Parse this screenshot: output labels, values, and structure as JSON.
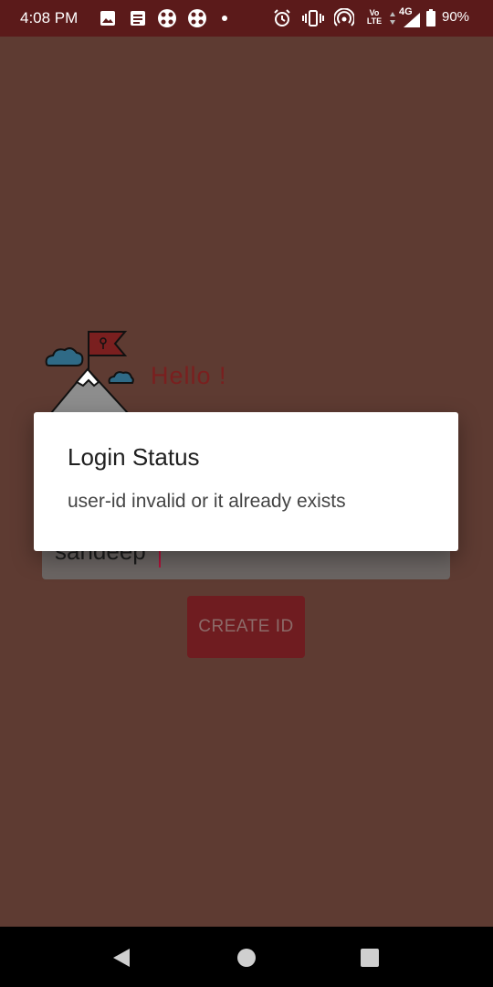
{
  "status_bar": {
    "time": "4:08 PM",
    "network": "4G",
    "battery": "90%",
    "icons": [
      "image-icon",
      "notes-icon",
      "app-icon",
      "app-icon",
      "dot-icon",
      "alarm-icon",
      "vibrate-icon",
      "hotspot-icon",
      "volte-icon",
      "signal-icon",
      "battery-icon"
    ],
    "volte_label": "Vo LTE"
  },
  "app": {
    "greeting": "Hello  !",
    "input_value": "sandeep",
    "create_button_label": "CREATE ID",
    "colors": {
      "background": "#5e3b32",
      "accent": "#6f1c20",
      "status_bar": "#5b1a1a"
    }
  },
  "dialog": {
    "title": "Login Status",
    "message": "user-id invalid or it already exists"
  },
  "nav_bar": {
    "buttons": [
      "back-icon",
      "home-icon",
      "recents-icon"
    ]
  }
}
